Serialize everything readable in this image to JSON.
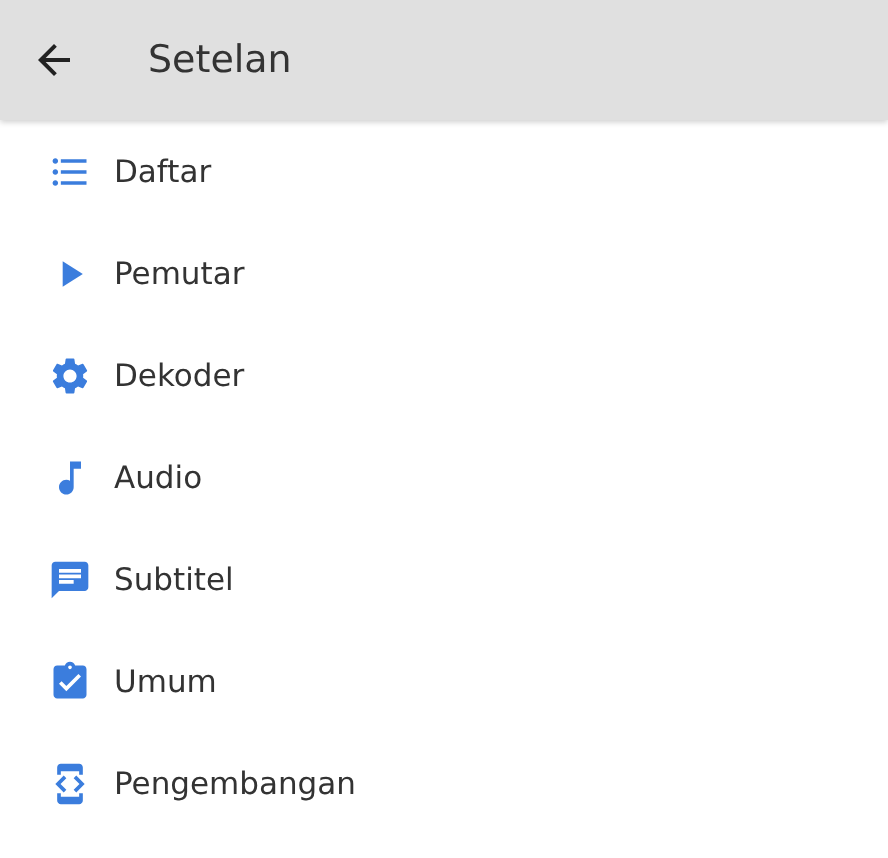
{
  "header": {
    "title": "Setelan"
  },
  "items": [
    {
      "kind": "list",
      "label": "Daftar"
    },
    {
      "kind": "player",
      "label": "Pemutar"
    },
    {
      "kind": "decoder",
      "label": "Dekoder"
    },
    {
      "kind": "audio",
      "label": "Audio"
    },
    {
      "kind": "subtitle",
      "label": "Subtitel"
    },
    {
      "kind": "general",
      "label": "Umum"
    },
    {
      "kind": "developer",
      "label": "Pengembangan"
    }
  ]
}
